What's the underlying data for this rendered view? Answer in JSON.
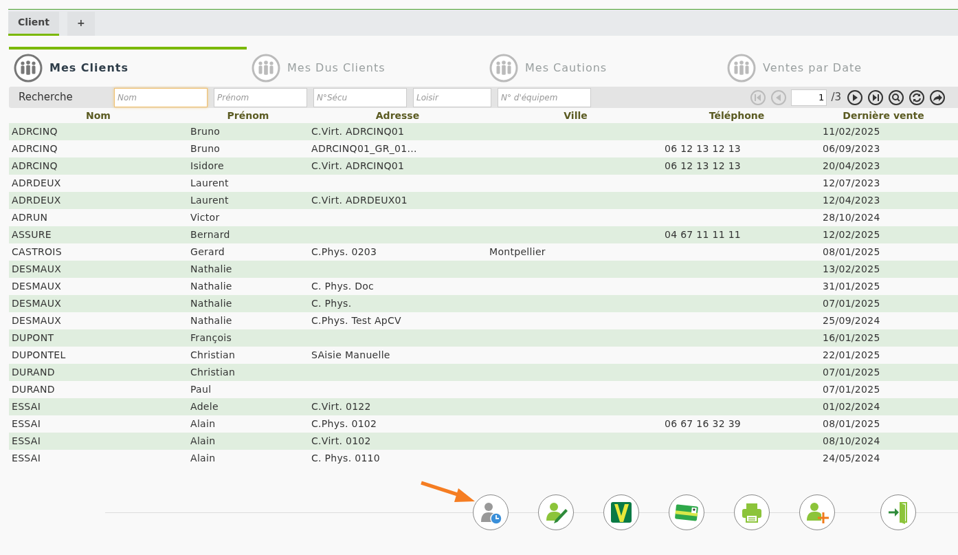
{
  "tabs": [
    {
      "label": "Client",
      "selected": true
    },
    {
      "label": "+",
      "selected": false
    }
  ],
  "sections": [
    {
      "label": "Mes Clients",
      "selected": true
    },
    {
      "label": "Mes Dus Clients",
      "selected": false
    },
    {
      "label": "Mes Cautions",
      "selected": false
    },
    {
      "label": "Ventes par Date",
      "selected": false
    }
  ],
  "search": {
    "label": "Recherche",
    "fields": [
      {
        "placeholder": "Nom",
        "focused": true
      },
      {
        "placeholder": "Prénom",
        "focused": false
      },
      {
        "placeholder": "N°Sécu",
        "focused": false
      },
      {
        "placeholder": "Loisir",
        "focused": false
      },
      {
        "placeholder": "N° d'équipem",
        "focused": false
      }
    ]
  },
  "pager": {
    "page": "1",
    "total": "/3"
  },
  "table": {
    "columns": [
      "Nom",
      "Prénom",
      "Adresse",
      "Ville",
      "Téléphone",
      "Dernière vente"
    ],
    "rows": [
      {
        "nom": "ADRCINQ",
        "prenom": "Bruno",
        "adresse": "C.Virt. ADRCINQ01",
        "derniere_vente": "11/02/2025"
      },
      {
        "nom": "ADRCINQ",
        "prenom": "Bruno",
        "adresse": "ADRCINQ01_GR_01...",
        "telephone": "06 12 13 12 13",
        "derniere_vente": "06/09/2023"
      },
      {
        "nom": "ADRCINQ",
        "prenom": "Isidore",
        "adresse": "C.Virt. ADRCINQ01",
        "telephone": "06 12 13 12 13",
        "derniere_vente": "20/04/2023"
      },
      {
        "nom": "ADRDEUX",
        "prenom": "Laurent",
        "derniere_vente": "12/07/2023"
      },
      {
        "nom": "ADRDEUX",
        "prenom": "Laurent",
        "adresse": "C.Virt. ADRDEUX01",
        "derniere_vente": "12/04/2023"
      },
      {
        "nom": "ADRUN",
        "prenom": "Victor",
        "derniere_vente": "28/10/2024"
      },
      {
        "nom": "ASSURE",
        "prenom": "Bernard",
        "telephone": "04 67 11 11 11",
        "derniere_vente": "12/02/2025"
      },
      {
        "nom": "CASTROIS",
        "prenom": "Gerard",
        "adresse": "C.Phys. 0203",
        "ville": "Montpellier",
        "derniere_vente": "08/01/2025"
      },
      {
        "nom": "DESMAUX",
        "prenom": "Nathalie",
        "derniere_vente": "13/02/2025"
      },
      {
        "nom": "DESMAUX",
        "prenom": "Nathalie",
        "adresse": "C. Phys. Doc",
        "derniere_vente": "31/01/2025"
      },
      {
        "nom": "DESMAUX",
        "prenom": "Nathalie",
        "adresse": "C. Phys.",
        "derniere_vente": "07/01/2025"
      },
      {
        "nom": "DESMAUX",
        "prenom": "Nathalie",
        "adresse": "C.Phys. Test ApCV",
        "derniere_vente": "25/09/2024"
      },
      {
        "nom": "DUPONT",
        "prenom": "François",
        "derniere_vente": "16/01/2025"
      },
      {
        "nom": "DUPONTEL",
        "prenom": "Christian",
        "adresse": "SAisie Manuelle",
        "derniere_vente": "22/01/2025"
      },
      {
        "nom": "DURAND",
        "prenom": "Christian",
        "derniere_vente": "07/01/2025"
      },
      {
        "nom": "DURAND",
        "prenom": "Paul",
        "derniere_vente": "07/01/2025"
      },
      {
        "nom": "ESSAI",
        "prenom": "Adele",
        "adresse": "C.Virt. 0122",
        "derniere_vente": "01/02/2024"
      },
      {
        "nom": "ESSAI",
        "prenom": "Alain",
        "adresse": "C.Phys. 0102",
        "telephone": "06 67 16 32 39",
        "derniere_vente": "08/01/2025"
      },
      {
        "nom": "ESSAI",
        "prenom": "Alain",
        "adresse": "C.Virt. 0102",
        "derniere_vente": "08/10/2024"
      },
      {
        "nom": "ESSAI",
        "prenom": "Alain",
        "adresse": "C. Phys. 0110",
        "derniere_vente": "24/05/2024"
      }
    ]
  }
}
